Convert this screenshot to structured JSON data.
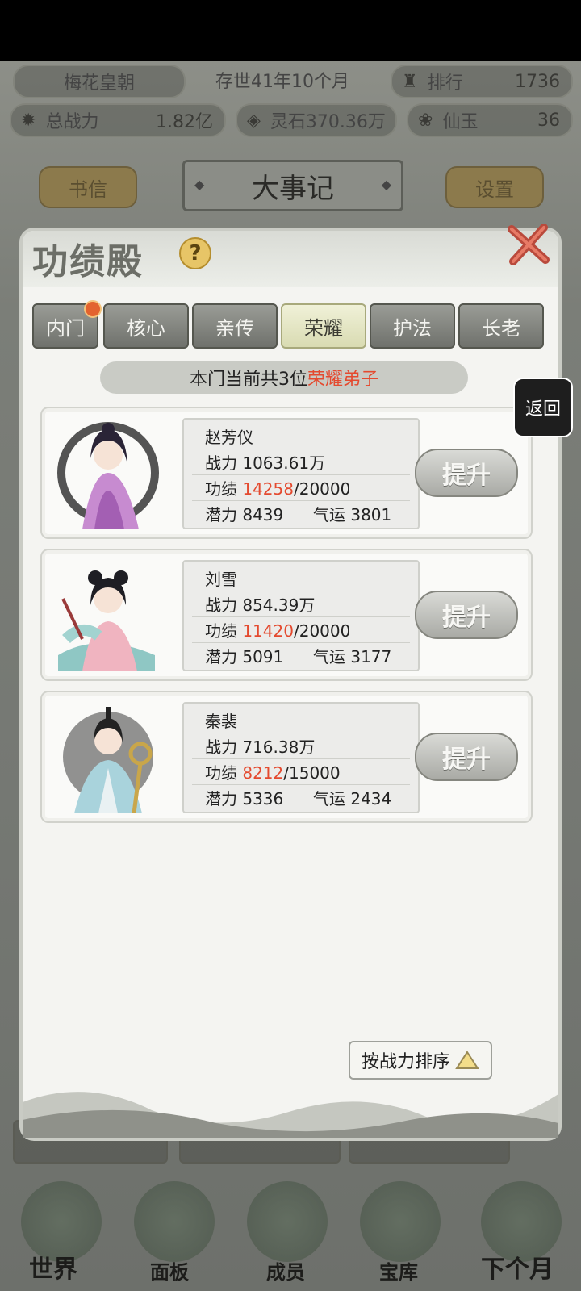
{
  "topbar": {
    "sect_name": "梅花皇朝",
    "age": "存世41年10个月",
    "rank_label": "排行",
    "rank_value": "1736",
    "power_label": "总战力",
    "power_value": "1.82亿",
    "spirit_stone": "灵石370.36万",
    "jade_label": "仙玉",
    "jade_value": "36"
  },
  "header": {
    "letters_button": "书信",
    "title": "大事记",
    "settings_button": "设置"
  },
  "modal": {
    "title": "功绩殿",
    "help_icon": "?",
    "tabs": [
      {
        "label": "内门",
        "active": false,
        "badge": true
      },
      {
        "label": "核心",
        "active": false
      },
      {
        "label": "亲传",
        "active": false
      },
      {
        "label": "荣耀",
        "active": true
      },
      {
        "label": "护法",
        "active": false
      },
      {
        "label": "长老",
        "active": false
      }
    ],
    "banner_prefix": "本门当前共3位",
    "banner_highlight": "荣耀弟子",
    "disciples": [
      {
        "name": "赵芳仪",
        "power_label": "战力",
        "power": "1063.61万",
        "merit_label": "功绩",
        "merit_current": "14258",
        "merit_total": "/20000",
        "potential_label": "潜力",
        "potential": "8439",
        "luck_label": "气运",
        "luck": "3801",
        "button": "提升"
      },
      {
        "name": "刘雪",
        "power_label": "战力",
        "power": "854.39万",
        "merit_label": "功绩",
        "merit_current": "11420",
        "merit_total": "/20000",
        "potential_label": "潜力",
        "potential": "5091",
        "luck_label": "气运",
        "luck": "3177",
        "button": "提升"
      },
      {
        "name": "秦裴",
        "power_label": "战力",
        "power": "716.38万",
        "merit_label": "功绩",
        "merit_current": "8212",
        "merit_total": "/15000",
        "potential_label": "潜力",
        "potential": "5336",
        "luck_label": "气运",
        "luck": "2434",
        "button": "提升"
      }
    ],
    "sort_button": "按战力排序"
  },
  "back_button": "返回",
  "bottom_nav": [
    {
      "label": "世界"
    },
    {
      "label": "面板"
    },
    {
      "label": "成员"
    },
    {
      "label": "宝库"
    },
    {
      "label": "下个月"
    }
  ],
  "colors": {
    "highlight_red": "#e44a2f",
    "tab_active": "#e4e6c2",
    "modal_bg": "#f4f4f1"
  }
}
